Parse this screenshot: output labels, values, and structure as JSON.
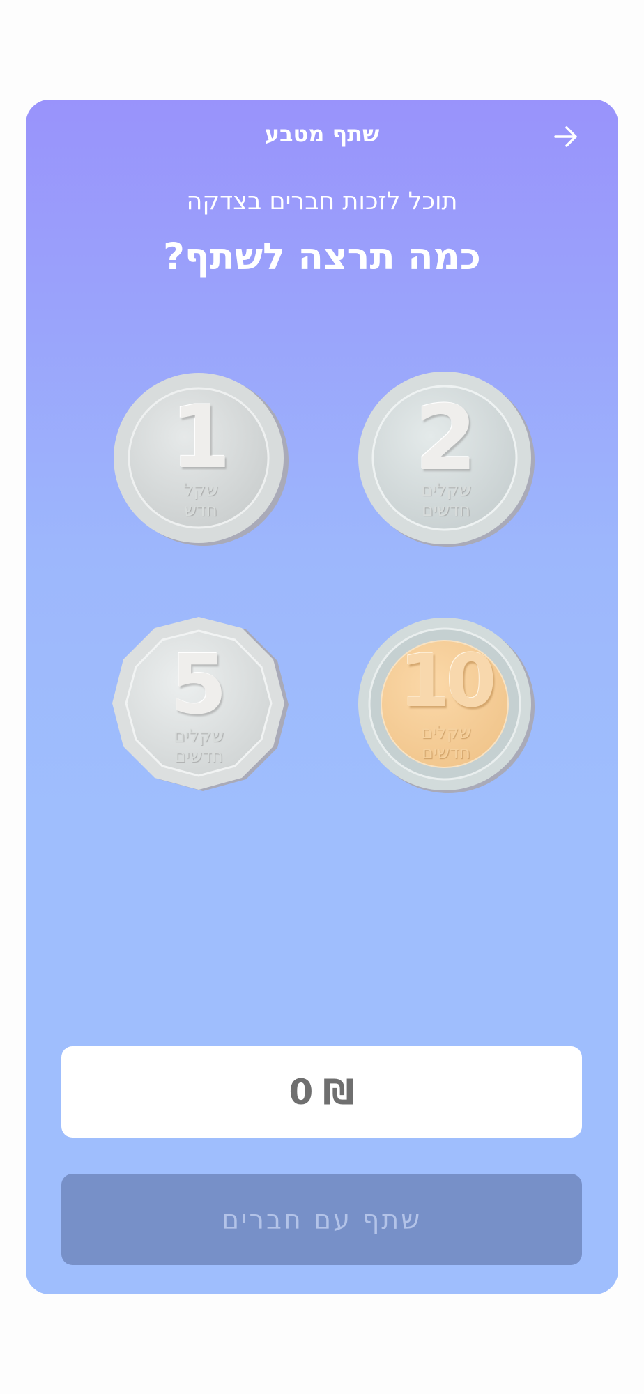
{
  "header": {
    "title": "שתף מטבע"
  },
  "subtitle": "תוכל לזכות חברים בצדקה",
  "question": "כמה תרצה לשתף?",
  "coins": [
    {
      "value": "1",
      "line1": "שקל",
      "line2": "חדש"
    },
    {
      "value": "2",
      "line1": "שקלים",
      "line2": "חדשים"
    },
    {
      "value": "5",
      "line1": "שקלים",
      "line2": "חדשים"
    },
    {
      "value": "10",
      "line1": "שקלים",
      "line2": "חדשים"
    }
  ],
  "amount": {
    "value": "0",
    "currency": "₪"
  },
  "share_button": {
    "label": "שתף עם חברים"
  },
  "colors": {
    "gradient_top": "#9993fb",
    "gradient_bottom": "#9fbefd",
    "share_button_bg": "#7790c8",
    "share_button_text": "#b3c3e8"
  }
}
